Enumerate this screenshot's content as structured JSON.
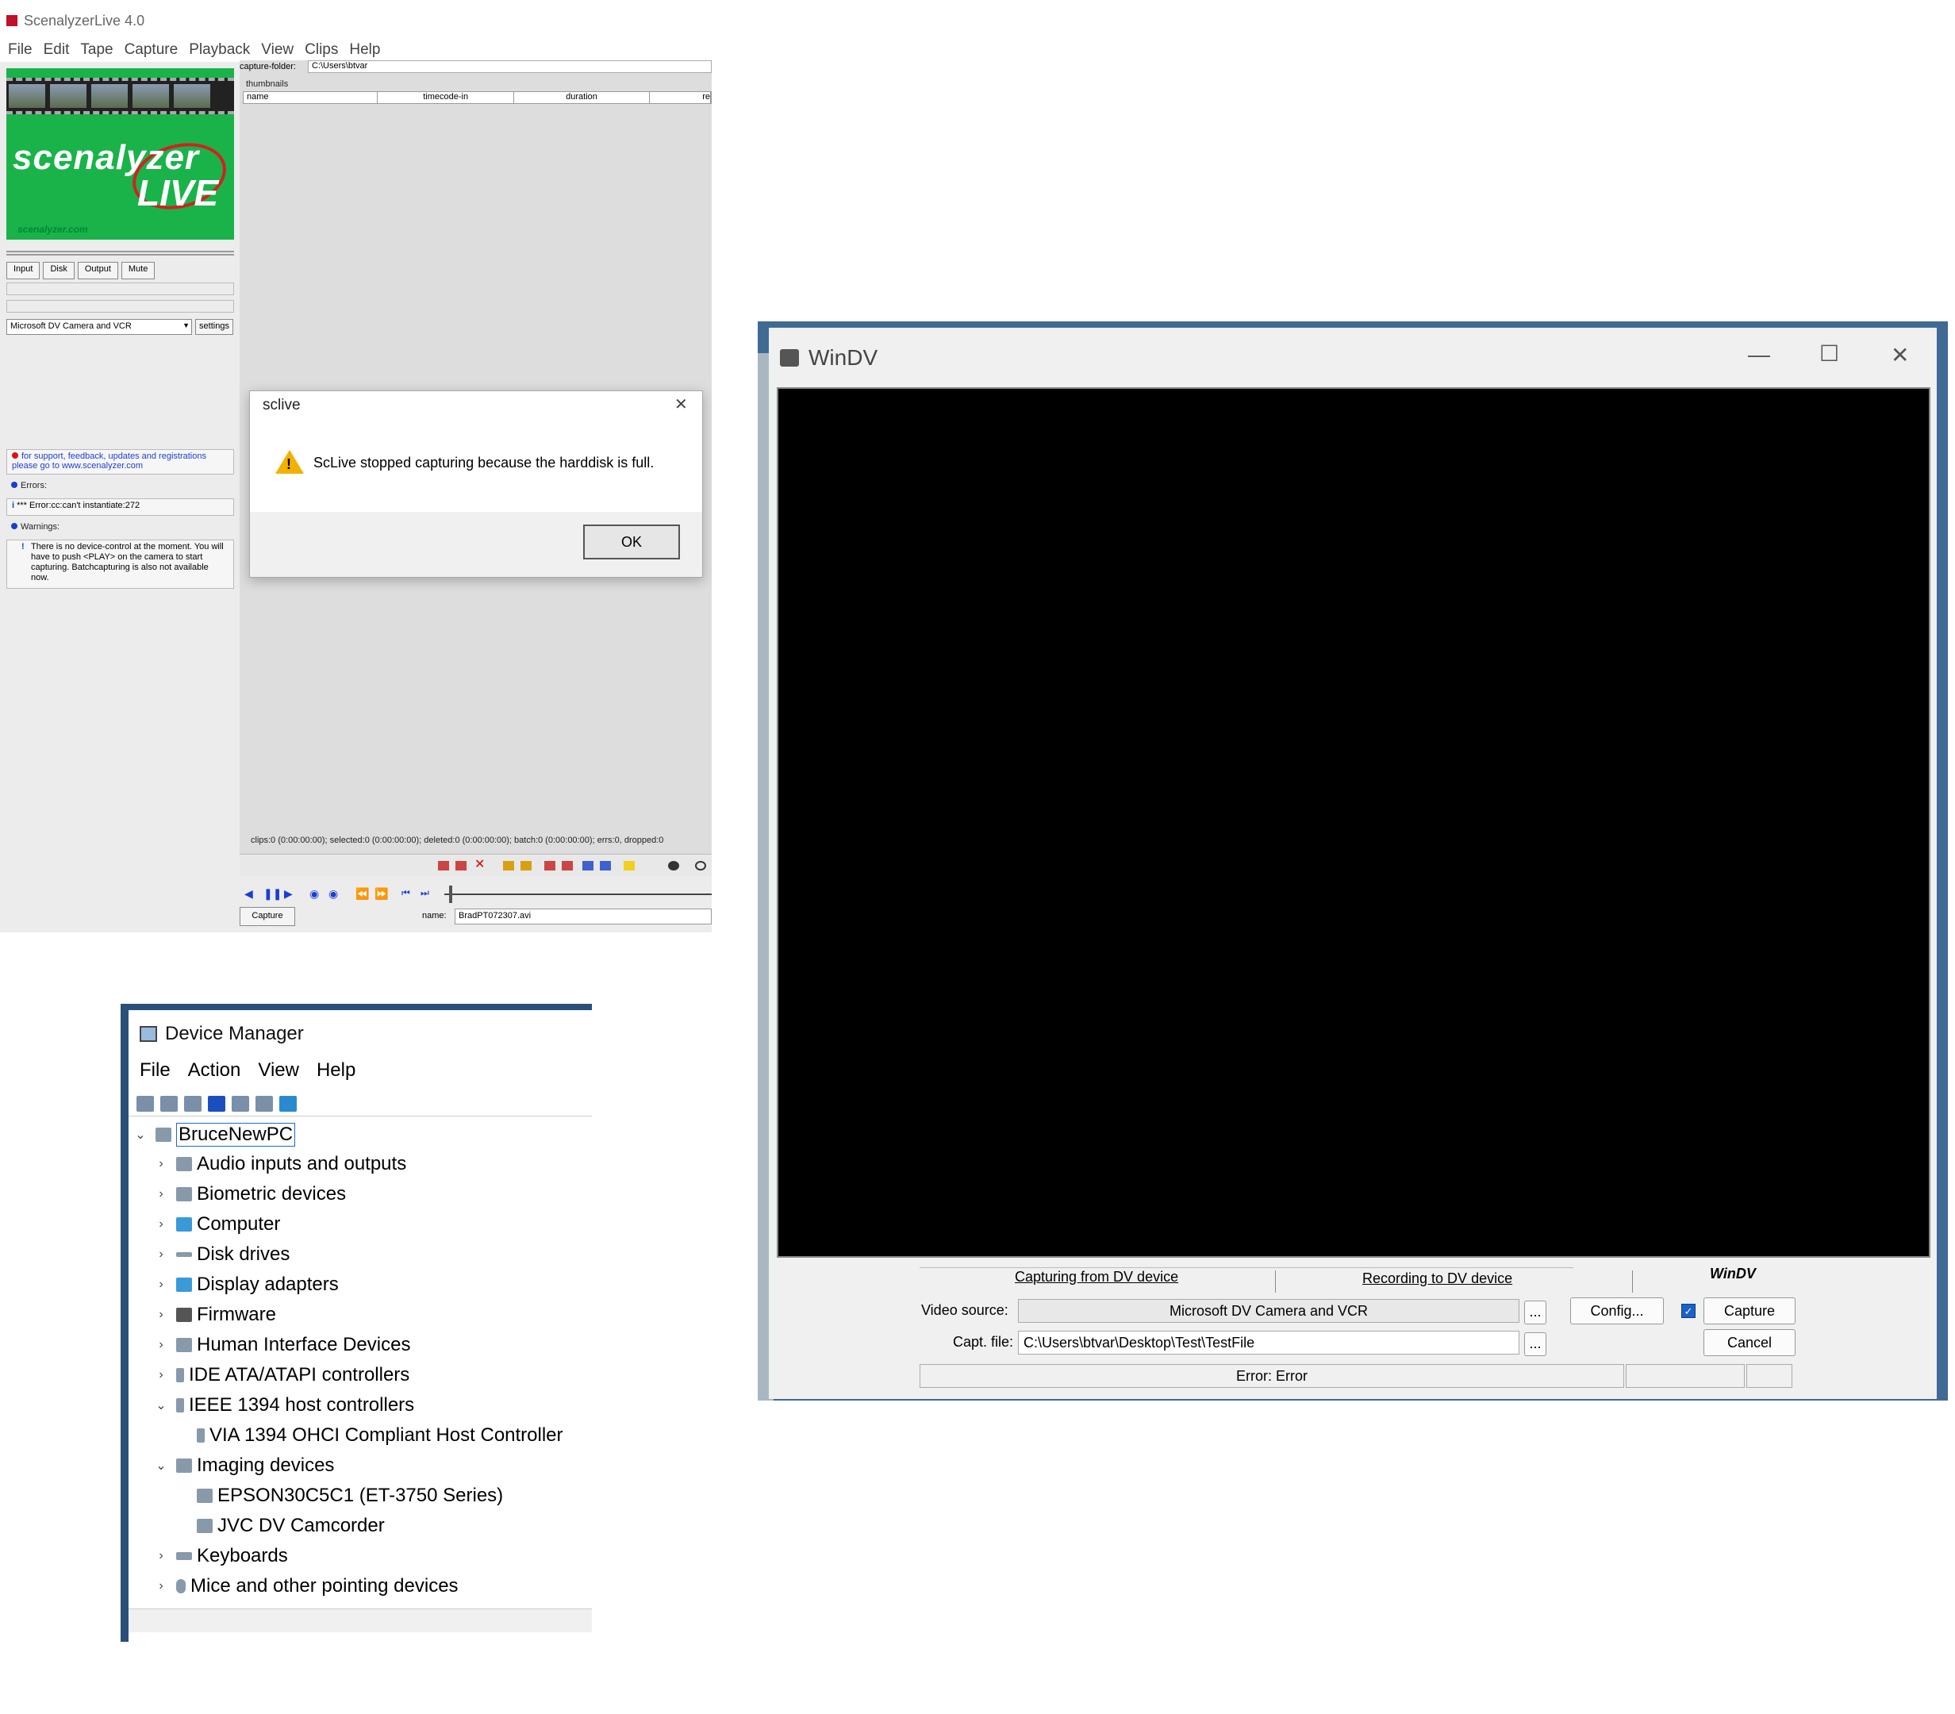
{
  "scenalyzer": {
    "title": "ScenalyzerLive 4.0",
    "menu": [
      "File",
      "Edit",
      "Tape",
      "Capture",
      "Playback",
      "View",
      "Clips",
      "Help"
    ],
    "logo_text_1": "scenalyzer",
    "logo_text_2": "LIVE",
    "logo_url": "scenalyzer.com",
    "tabs": [
      "Input",
      "Disk",
      "Output",
      "Mute"
    ],
    "device_select": "Microsoft DV Camera and VCR",
    "settings_label": "settings",
    "support_text": "for support, feedback, updates and registrations please go to www.scenalyzer.com",
    "errors_label": "Errors:",
    "error_text": "*** Error:cc:can't instantiate:272",
    "warnings_label": "Warnings:",
    "warning_text": "There is no device-control at the moment. You will have to push <PLAY> on the camera to start capturing. Batchcapturing is also not available now.",
    "capture_folder_label": "capture-folder:",
    "capture_folder_value": "C:\\Users\\btvar",
    "thumbnails_label": "thumbnails",
    "columns": [
      "name",
      "timecode-in",
      "duration",
      "re"
    ],
    "status": "clips:0 (0:00:00:00); selected:0 (0:00:00:00); deleted:0 (0:00:00:00); batch:0 (0:00:00:00); errs:0, dropped:0",
    "capture_button": "Capture",
    "name_label": "name:",
    "name_value": "BradPT072307.avi"
  },
  "dialog": {
    "title": "sclive",
    "message": "ScLive stopped capturing because the harddisk is full.",
    "ok": "OK"
  },
  "device_manager": {
    "title": "Device Manager",
    "menu": [
      "File",
      "Action",
      "View",
      "Help"
    ],
    "root": "BruceNewPC",
    "items": [
      "Audio inputs and outputs",
      "Biometric devices",
      "Computer",
      "Disk drives",
      "Display adapters",
      "Firmware",
      "Human Interface Devices",
      "IDE ATA/ATAPI controllers",
      "IEEE 1394 host controllers",
      "VIA 1394 OHCI Compliant Host Controller",
      "Imaging devices",
      "EPSON30C5C1 (ET-3750 Series)",
      "JVC DV Camcorder",
      "Keyboards",
      "Mice and other pointing devices"
    ]
  },
  "windv": {
    "title": "WinDV",
    "tab_capture": "Capturing from DV device",
    "tab_record": "Recording to DV device",
    "brand": "WinDV",
    "video_source_label": "Video source:",
    "video_source_value": "Microsoft DV Camera and VCR",
    "capt_file_label": "Capt. file:",
    "capt_file_value": "C:\\Users\\btvar\\Desktop\\Test\\TestFile",
    "browse": "...",
    "config": "Config...",
    "capture": "Capture",
    "cancel": "Cancel",
    "status": "Error: Error"
  }
}
